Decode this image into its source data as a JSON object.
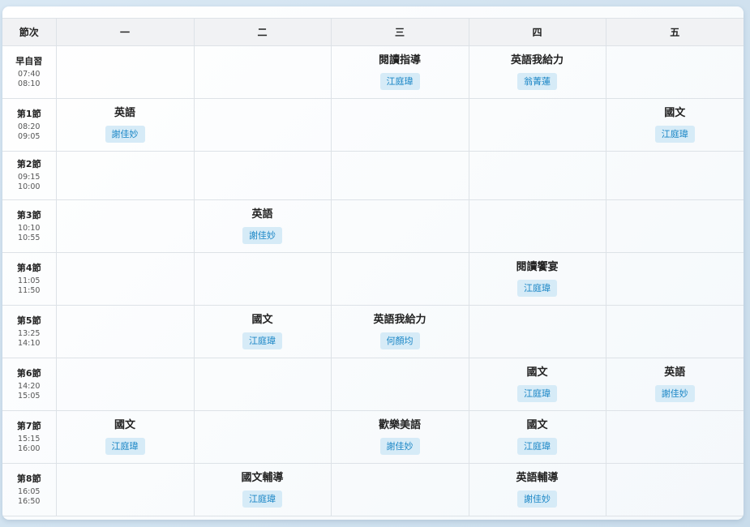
{
  "headers": [
    "節次",
    "一",
    "二",
    "三",
    "四",
    "五"
  ],
  "periods": [
    {
      "name": "早自習",
      "start": "07:40",
      "end": "08:10"
    },
    {
      "name": "第1節",
      "start": "08:20",
      "end": "09:05"
    },
    {
      "name": "第2節",
      "start": "09:15",
      "end": "10:00"
    },
    {
      "name": "第3節",
      "start": "10:10",
      "end": "10:55"
    },
    {
      "name": "第4節",
      "start": "11:05",
      "end": "11:50"
    },
    {
      "name": "第5節",
      "start": "13:25",
      "end": "14:10"
    },
    {
      "name": "第6節",
      "start": "14:20",
      "end": "15:05"
    },
    {
      "name": "第7節",
      "start": "15:15",
      "end": "16:00"
    },
    {
      "name": "第8節",
      "start": "16:05",
      "end": "16:50"
    }
  ],
  "schedule": [
    [
      null,
      null,
      {
        "subject": "閱讀指導",
        "teacher": "江庭瑋"
      },
      {
        "subject": "英語我給力",
        "teacher": "翁菁蓮"
      },
      null
    ],
    [
      {
        "subject": "英語",
        "teacher": "謝佳妙"
      },
      null,
      null,
      null,
      {
        "subject": "國文",
        "teacher": "江庭瑋"
      }
    ],
    [
      null,
      null,
      null,
      null,
      null
    ],
    [
      null,
      {
        "subject": "英語",
        "teacher": "謝佳妙"
      },
      null,
      null,
      null
    ],
    [
      null,
      null,
      null,
      {
        "subject": "閱讀饗宴",
        "teacher": "江庭瑋"
      },
      null
    ],
    [
      null,
      {
        "subject": "國文",
        "teacher": "江庭瑋"
      },
      {
        "subject": "英語我給力",
        "teacher": "何顏均"
      },
      null,
      null
    ],
    [
      null,
      null,
      null,
      {
        "subject": "國文",
        "teacher": "江庭瑋"
      },
      {
        "subject": "英語",
        "teacher": "謝佳妙"
      }
    ],
    [
      {
        "subject": "國文",
        "teacher": "江庭瑋"
      },
      null,
      {
        "subject": "歡樂美語",
        "teacher": "謝佳妙"
      },
      {
        "subject": "國文",
        "teacher": "江庭瑋"
      },
      null
    ],
    [
      null,
      {
        "subject": "國文輔導",
        "teacher": "江庭瑋"
      },
      null,
      {
        "subject": "英語輔導",
        "teacher": "謝佳妙"
      },
      null
    ]
  ]
}
